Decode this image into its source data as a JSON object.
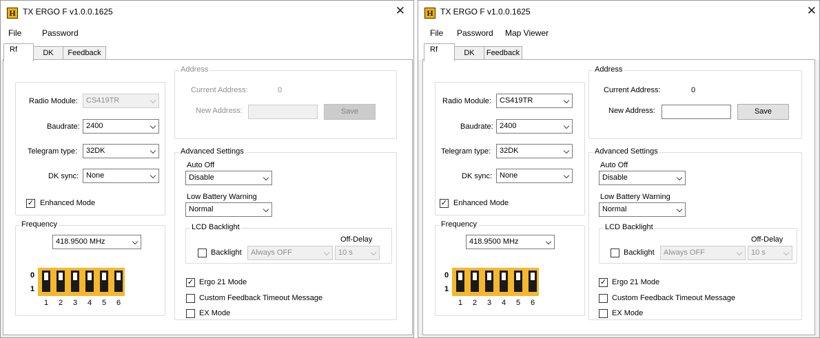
{
  "left": {
    "title": "TX ERGO F v1.0.0.1625",
    "menu": [
      "File",
      "Password"
    ],
    "tabs": [
      "Rf",
      "DK",
      "Feedback"
    ],
    "radio_module": {
      "label": "Radio Module:",
      "value": "CS419TR"
    },
    "baudrate": {
      "label": "Baudrate:",
      "value": "2400"
    },
    "telegram_type": {
      "label": "Telegram type:",
      "value": "32DK"
    },
    "dk_sync": {
      "label": "DK sync:",
      "value": "None"
    },
    "enhanced_mode": "Enhanced Mode",
    "frequency": {
      "caption": "Frequency",
      "value": "418.9500 MHz"
    },
    "dip": {
      "row0": "0",
      "row1": "1",
      "numbers": [
        "1",
        "2",
        "3",
        "4",
        "5",
        "6"
      ]
    },
    "address": {
      "caption": "Address",
      "current_label": "Current Address:",
      "current_value": "0",
      "new_label": "New Address:",
      "save": "Save"
    },
    "advanced": {
      "caption": "Advanced Settings",
      "auto_off_label": "Auto Off",
      "auto_off_value": "Disable",
      "low_battery_label": "Low Battery Warning",
      "low_battery_value": "Normal",
      "lcd_caption": "LCD Backlight",
      "off_delay_label": "Off-Delay",
      "backlight_label": "Backlight",
      "backlight_value": "Always OFF",
      "off_delay_value": "10 s",
      "ergo21": "Ergo 21 Mode",
      "custom_feedback": "Custom Feedback Timeout Message",
      "ex_mode": "EX Mode"
    }
  },
  "right": {
    "title": "TX ERGO F v1.0.0.1625",
    "menu": [
      "File",
      "Password",
      "Map Viewer"
    ],
    "tabs": [
      "Rf",
      "DK",
      "Feedback"
    ],
    "radio_module": {
      "label": "Radio Module:",
      "value": "CS419TR"
    },
    "baudrate": {
      "label": "Baudrate:",
      "value": "2400"
    },
    "telegram_type": {
      "label": "Telegram type:",
      "value": "32DK"
    },
    "dk_sync": {
      "label": "DK sync:",
      "value": "None"
    },
    "enhanced_mode": "Enhanced Mode",
    "frequency": {
      "caption": "Frequency",
      "value": "418.9500 MHz"
    },
    "dip": {
      "row0": "0",
      "row1": "1",
      "numbers": [
        "1",
        "2",
        "3",
        "4",
        "5",
        "6"
      ]
    },
    "address": {
      "caption": "Address",
      "current_label": "Current Address:",
      "current_value": "0",
      "new_label": "New Address:",
      "save": "Save"
    },
    "advanced": {
      "caption": "Advanced Settings",
      "auto_off_label": "Auto Off",
      "auto_off_value": "Disable",
      "low_battery_label": "Low Battery Warning",
      "low_battery_value": "Normal",
      "lcd_caption": "LCD Backlight",
      "off_delay_label": "Off-Delay",
      "backlight_label": "Backlight",
      "backlight_value": "Always OFF",
      "off_delay_value": "10 s",
      "ergo21": "Ergo 21 Mode",
      "custom_feedback": "Custom Feedback Timeout Message",
      "ex_mode": "EX Mode"
    }
  },
  "state": {
    "enhanced_mode": true,
    "ergo21": true,
    "custom_feedback": false,
    "ex_mode": false,
    "backlight": false
  },
  "colors": {
    "dip_background": "#f5b72d",
    "dip_switch": "#1a1a1a",
    "app_icon": "#f5b400"
  }
}
